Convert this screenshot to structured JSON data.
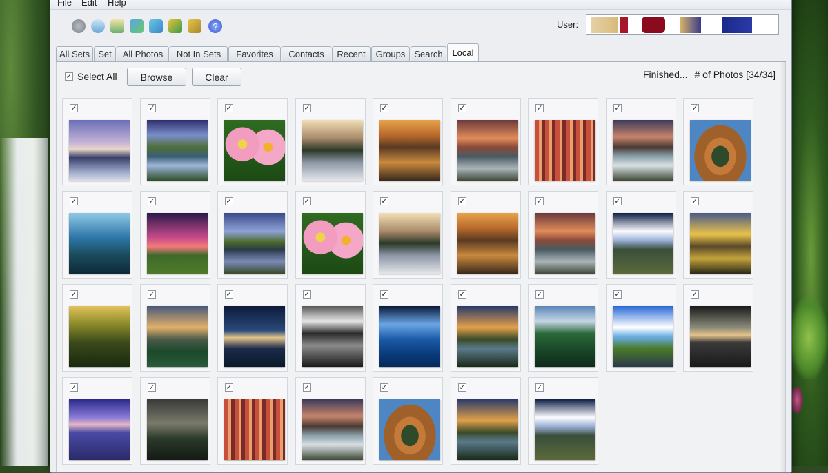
{
  "menu": [
    "File",
    "Edit",
    "Help"
  ],
  "toolbar": {
    "icons": [
      "globe-icon",
      "search-people-icon",
      "notepad-icon",
      "upload-icon",
      "download-icon",
      "picture-icon",
      "folder-icon",
      "help-icon"
    ],
    "user_label": "User:"
  },
  "tabs": [
    "All Sets",
    "Set",
    "All Photos",
    "Not In Sets",
    "Favorites",
    "Contacts",
    "Recent",
    "Groups",
    "Search",
    "Local"
  ],
  "active_tab": "Local",
  "actions": {
    "select_all": "Select All",
    "select_all_checked": "✓",
    "browse": "Browse",
    "clear": "Clear"
  },
  "status": {
    "state": "Finished...",
    "count": "# of Photos [34/34]"
  },
  "photos": [
    {
      "art": "dusk"
    },
    {
      "art": "river"
    },
    {
      "art": "flower"
    },
    {
      "art": "winter"
    },
    {
      "art": "canyon"
    },
    {
      "art": "coast"
    },
    {
      "art": "slot"
    },
    {
      "art": "falls"
    },
    {
      "art": "bend"
    },
    {
      "art": "blue"
    },
    {
      "art": "pink"
    },
    {
      "art": "lake"
    },
    {
      "art": "flower"
    },
    {
      "art": "winter"
    },
    {
      "art": "canyon"
    },
    {
      "art": "coast"
    },
    {
      "art": "clouds"
    },
    {
      "art": "gold"
    },
    {
      "art": "forest"
    },
    {
      "art": "glow"
    },
    {
      "art": "night"
    },
    {
      "art": "bw"
    },
    {
      "art": "sea"
    },
    {
      "art": "sunset"
    },
    {
      "art": "green"
    },
    {
      "art": "sky"
    },
    {
      "art": "storm"
    },
    {
      "art": "violet"
    },
    {
      "art": "dark"
    },
    {
      "art": "slot"
    },
    {
      "art": "falls"
    },
    {
      "art": "bend"
    },
    {
      "art": "sunset"
    },
    {
      "art": "clouds"
    }
  ],
  "photo_checked": "✓"
}
